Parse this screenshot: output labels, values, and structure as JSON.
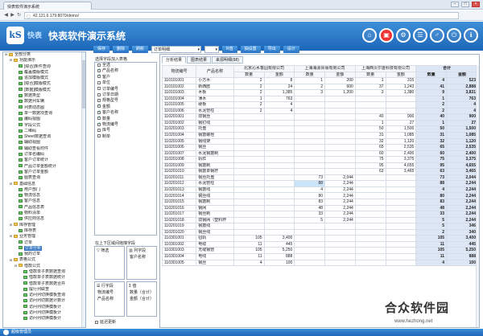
{
  "browser": {
    "tab_title": "快表软件演示系统",
    "url": "42.121.6.179:8070/demo/",
    "nav": [
      "◀",
      "▶",
      "↻"
    ],
    "win_buttons": [
      "–",
      "□",
      "×"
    ]
  },
  "app": {
    "logo_text": "kS",
    "brand": "快表",
    "title": "快表软件演示系统",
    "header_icons": [
      "home-icon",
      "document-icon",
      "gear-icon",
      "users-icon",
      "key-icon",
      "power-icon",
      "info-icon"
    ],
    "header_glyphs": [
      "⌂",
      "▣",
      "⚙",
      "☰",
      "♂",
      "⏻",
      "ℹ"
    ],
    "accent": "#1d66b8"
  },
  "sidebar": {
    "items": [
      {
        "label": "全部分类",
        "level": 0,
        "type": "folder"
      },
      {
        "label": "功能演示",
        "level": 1,
        "type": "folder"
      },
      {
        "label": "[综合]条件查询",
        "level": 2,
        "type": "form"
      },
      {
        "label": "覆盖模版模式",
        "level": 2,
        "type": "form"
      },
      {
        "label": "追加模版模式",
        "level": 2,
        "type": "form"
      },
      {
        "label": "[综合]模版模式",
        "level": 2,
        "type": "form"
      },
      {
        "label": "[数据]模版模式",
        "level": 2,
        "type": "form"
      },
      {
        "label": "数据类型",
        "level": 2,
        "type": "form"
      },
      {
        "label": "数据列车辆",
        "level": 2,
        "type": "form"
      },
      {
        "label": "列表动态图",
        "level": 2,
        "type": "form"
      },
      {
        "label": "单一数据项查询",
        "level": 2,
        "type": "form"
      },
      {
        "label": "编码视图",
        "level": 2,
        "type": "form"
      },
      {
        "label": "字段公式",
        "level": 2,
        "type": "form"
      },
      {
        "label": "二维码",
        "level": 2,
        "type": "form"
      },
      {
        "label": "Sheet数据查询",
        "level": 2,
        "type": "form"
      },
      {
        "label": "辅助视图",
        "level": 2,
        "type": "form"
      },
      {
        "label": "辅助查看附件",
        "level": 2,
        "type": "form"
      },
      {
        "label": "订单名编码",
        "level": 2,
        "type": "form"
      },
      {
        "label": "客户订单统计",
        "level": 2,
        "type": "form"
      },
      {
        "label": "产品订单金额统计",
        "level": 2,
        "type": "form"
      },
      {
        "label": "客户订单金额",
        "level": 2,
        "type": "form"
      },
      {
        "label": "图表查询",
        "level": 2,
        "type": "form"
      },
      {
        "label": "基础信息",
        "level": 1,
        "type": "folder"
      },
      {
        "label": "用户部门",
        "level": 2,
        "type": "form"
      },
      {
        "label": "物流信息",
        "level": 2,
        "type": "form"
      },
      {
        "label": "客户信息",
        "level": 2,
        "type": "form"
      },
      {
        "label": "产品信息表",
        "level": 2,
        "type": "form"
      },
      {
        "label": "物料清单",
        "level": 2,
        "type": "form"
      },
      {
        "label": "供应商信息",
        "level": 2,
        "type": "form"
      },
      {
        "label": "库存管理",
        "level": 1,
        "type": "folder"
      },
      {
        "label": "库存表",
        "level": 2,
        "type": "form"
      },
      {
        "label": "业务管理",
        "level": 1,
        "type": "folder"
      },
      {
        "label": "订单",
        "level": 2,
        "type": "form"
      },
      {
        "label": "订单分析",
        "level": 2,
        "type": "form",
        "selected": true
      },
      {
        "label": "我的订单",
        "level": 2,
        "type": "form"
      },
      {
        "label": "表格公式",
        "level": 1,
        "type": "folder"
      },
      {
        "label": "借款公式",
        "level": 2,
        "type": "folder"
      },
      {
        "label": "借款单子表数据查询",
        "level": 3,
        "type": "form"
      },
      {
        "label": "借款单子表数据统计",
        "level": 3,
        "type": "form"
      },
      {
        "label": "借款单子表数据合并",
        "level": 3,
        "type": "form"
      },
      {
        "label": "提行列联查",
        "level": 3,
        "type": "form"
      },
      {
        "label": "访问列切换模板查询",
        "level": 3,
        "type": "form"
      },
      {
        "label": "访问列切数据计数计",
        "level": 3,
        "type": "form"
      },
      {
        "label": "访问列切换模板计",
        "level": 3,
        "type": "form"
      },
      {
        "label": "访问列切换模板计",
        "level": 3,
        "type": "form"
      },
      {
        "label": "访问列切换模板计",
        "level": 3,
        "type": "form"
      }
    ]
  },
  "toolbar": {
    "buttons": [
      "保存",
      "删除",
      "刷新"
    ],
    "select_value": "订单明细",
    "select_small": "",
    "right_buttons": [
      "R值",
      "抽设置",
      "导出",
      "设计"
    ]
  },
  "fields": {
    "title": "选择字段加入表格",
    "items": [
      {
        "label": "全选",
        "checked": false
      },
      {
        "label": "产品名称",
        "checked": true
      },
      {
        "label": "客户",
        "checked": true
      },
      {
        "label": "单位",
        "checked": false
      },
      {
        "label": "订单编号",
        "checked": false
      },
      {
        "label": "订单日期",
        "checked": false
      },
      {
        "label": "规格型号",
        "checked": false
      },
      {
        "label": "金额",
        "checked": true
      },
      {
        "label": "客户名称",
        "checked": true
      },
      {
        "label": "数量",
        "checked": true
      },
      {
        "label": "物流编号",
        "checked": true
      },
      {
        "label": "库号",
        "checked": false
      },
      {
        "label": "制单",
        "checked": false
      }
    ],
    "hint": "在上下区域间拖拽字段",
    "zones": {
      "filter": "筛选",
      "column": "列字段",
      "column_items": [
        "客户名称"
      ],
      "row": "行字段",
      "row_items": [
        "物流编号",
        "产品名称"
      ],
      "value": "值",
      "value_items": [
        "数量（合计）",
        "金额（合计）"
      ]
    },
    "footer": "延迟更新"
  },
  "report": {
    "tabs": [
      "分析结果",
      "图表结果",
      "来源明细(88)"
    ],
    "headers": {
      "code": "物流编号",
      "name": "产品名称",
      "groups": [
        "北京沁水香园有限公司",
        "上海海源贸易有限公司",
        "上海西贝尔首科技有限公司"
      ],
      "total": "合计",
      "qty": "数量",
      "amt": "金额"
    },
    "rows": [
      [
        "110101001",
        "小方木",
        "2",
        "8",
        "1",
        "200",
        "1",
        "315",
        "4",
        "523"
      ],
      [
        "110101002",
        "新西欧",
        "2",
        "24",
        "2",
        "600",
        "37",
        "1,243",
        "41",
        "2,888"
      ],
      [
        "110101003",
        "木板",
        "2",
        "1,385",
        "3",
        "1,200",
        "3",
        "1,380",
        "9",
        "3,831"
      ],
      [
        "110101004",
        "薄木",
        "1",
        "763",
        "",
        "",
        "",
        "",
        "1",
        "763"
      ],
      [
        "110101005",
        "硬板",
        "2",
        "4",
        "",
        "",
        "",
        "",
        "2",
        "4"
      ],
      [
        "110101006",
        "水泥管柱",
        "2",
        "4",
        "",
        "",
        "",
        "",
        "2",
        "4"
      ],
      [
        "110201001",
        "双钢丝",
        "",
        "",
        "",
        "",
        "40",
        "900",
        "40",
        "900"
      ],
      [
        "110201002",
        "钢钉线",
        "",
        "",
        "",
        "",
        "1",
        "27",
        "1",
        "27"
      ],
      [
        "110201003",
        "托盘",
        "",
        "",
        "",
        "",
        "50",
        "1,500",
        "50",
        "1,500"
      ],
      [
        "110201004",
        "钢筋螺栓",
        "",
        "",
        "",
        "",
        "31",
        "1,085",
        "31",
        "1,085"
      ],
      [
        "110201005",
        "钢线架",
        "",
        "",
        "",
        "",
        "32",
        "1,120",
        "32",
        "1,120"
      ],
      [
        "110201006",
        "钢丝",
        "",
        "",
        "",
        "",
        "65",
        "2,535",
        "65",
        "2,535"
      ],
      [
        "110201007",
        "水泥钢筋制",
        "",
        "",
        "",
        "",
        "60",
        "2,400",
        "60",
        "2,400"
      ],
      [
        "110201008",
        "轨杠",
        "",
        "",
        "",
        "",
        "75",
        "3,375",
        "75",
        "3,375"
      ],
      [
        "110201009",
        "钢筋制",
        "",
        "",
        "",
        "",
        "95",
        "4,655",
        "95",
        "4,655"
      ],
      [
        "110201010",
        "钢筋单钢杆",
        "",
        "",
        "",
        "",
        "63",
        "3,465",
        "63",
        "3,465"
      ],
      [
        "110201011",
        "钢丝托盘",
        "",
        "",
        "73",
        "2,044",
        "",
        "",
        "73",
        "2,044"
      ],
      [
        "110201012",
        "水泥管柱",
        "",
        "",
        "88",
        "2,244",
        "",
        "",
        "88",
        "2,244"
      ],
      [
        "110201013",
        "钢筋线",
        "",
        "",
        "4",
        "2,244",
        "",
        "",
        "4",
        "2,244"
      ],
      [
        "110201014",
        "钢丝线",
        "",
        "",
        "80",
        "2,244",
        "",
        "",
        "80",
        "2,244"
      ],
      [
        "110201015",
        "钢筋制",
        "",
        "",
        "83",
        "2,244",
        "",
        "",
        "83",
        "2,244"
      ],
      [
        "110201016",
        "钢网",
        "",
        "",
        "48",
        "2,244",
        "",
        "",
        "48",
        "2,244"
      ],
      [
        "110201017",
        "钢丝制",
        "",
        "",
        "33",
        "2,244",
        "",
        "",
        "33",
        "2,244"
      ],
      [
        "110201018",
        "双钢网（塑料杯",
        "",
        "",
        "5",
        "2,244",
        "",
        "",
        "5",
        "2,244"
      ],
      [
        "110201019",
        "钢筋线",
        "",
        "",
        "",
        "",
        "",
        "",
        "5",
        "346"
      ],
      [
        "110201020",
        "钢丝线",
        "",
        "",
        "",
        "",
        "",
        "",
        "2",
        "340"
      ],
      [
        "110301001",
        "钮轨",
        "105",
        "3,400",
        "",
        "",
        "",
        "",
        "105",
        "3,400"
      ],
      [
        "110301002",
        "电缆",
        "11",
        "445",
        "",
        "",
        "",
        "",
        "11",
        "445"
      ],
      [
        "110301003",
        "无缝钢管",
        "105",
        "5,250",
        "",
        "",
        "",
        "",
        "105",
        "5,250"
      ],
      [
        "110301004",
        "电线",
        "11",
        "888",
        "",
        "",
        "",
        "",
        "11",
        "888"
      ],
      [
        "110301005",
        "钢丝",
        "4",
        "100",
        "",
        "",
        "",
        "",
        "4",
        "100"
      ]
    ],
    "highlight_cell": [
      17,
      4
    ]
  },
  "status": {
    "text": "超级管理员"
  },
  "watermark": {
    "title": "合众软件园",
    "url": "www.hezhong.net"
  }
}
